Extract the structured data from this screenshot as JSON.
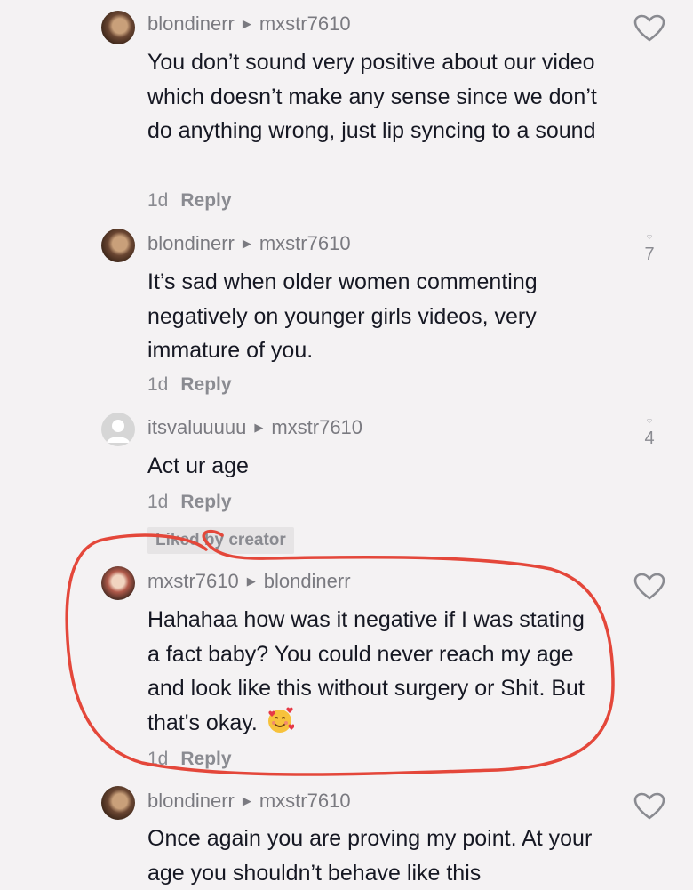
{
  "comments": [
    {
      "author": "blondinerr",
      "reply_to": "mxstr7610",
      "text": "You don’t sound very positive about our video which doesn’t make any sense since we don’t do anything wrong, just lip syncing to a sound",
      "time": "1d",
      "reply_label": "Reply",
      "likes": ""
    },
    {
      "author": "blondinerr",
      "reply_to": "mxstr7610",
      "text": "It’s sad when older women commenting negatively on younger girls videos, very immature of you.",
      "time": "1d",
      "reply_label": "Reply",
      "likes": "7"
    },
    {
      "author": "itsvaluuuuu",
      "reply_to": "mxstr7610",
      "text": "Act ur age",
      "time": "1d",
      "reply_label": "Reply",
      "likes": "4",
      "badge": "Liked by creator"
    },
    {
      "author": "mxstr7610",
      "reply_to": "blondinerr",
      "text": "Hahahaa how was it negative if I was stating a fact baby? You could never reach my age and look like this without surgery or Shit. But that's okay.",
      "time": "1d",
      "reply_label": "Reply",
      "likes": ""
    },
    {
      "author": "blondinerr",
      "reply_to": "mxstr7610",
      "text": "Once again you are proving my point. At your age you shouldn’t behave like this",
      "likes": ""
    }
  ],
  "colors": {
    "background": "#f4f2f3",
    "annotation": "#e4473a",
    "secondary_text": "#8a8b91"
  },
  "icons": {
    "like": "heart-outline-icon",
    "arrow": "triangle-right-icon",
    "emoji": "smiling-face-with-hearts"
  }
}
